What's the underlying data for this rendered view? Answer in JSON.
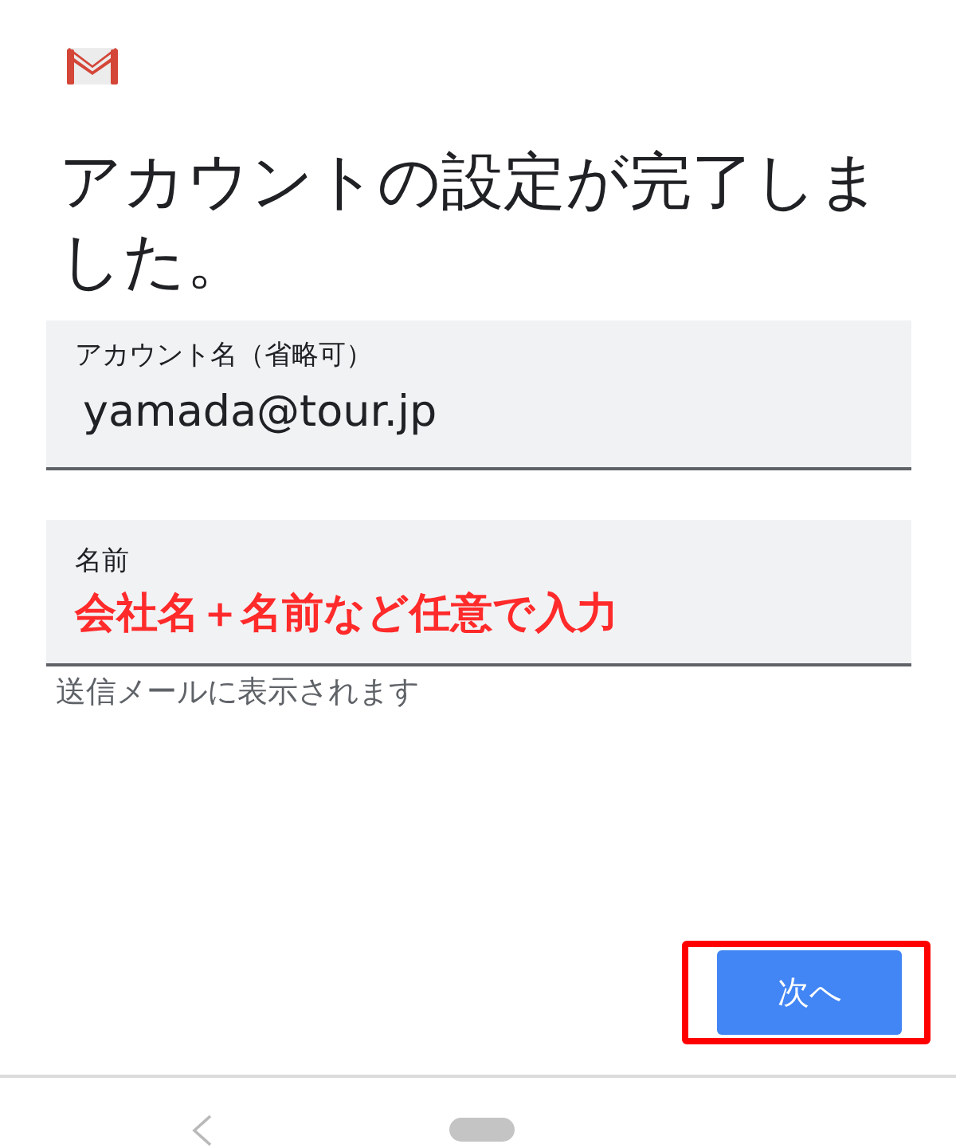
{
  "title": "アカウントの設定が完了しました。",
  "fields": [
    {
      "label": "アカウント名（省略可）",
      "value": "yamada@tour.jp"
    },
    {
      "label": "名前",
      "annotation": "会社名＋名前など任意で入力",
      "helper": "送信メールに表示されます"
    }
  ],
  "next_button": {
    "label": "次へ",
    "highlighted": true
  }
}
